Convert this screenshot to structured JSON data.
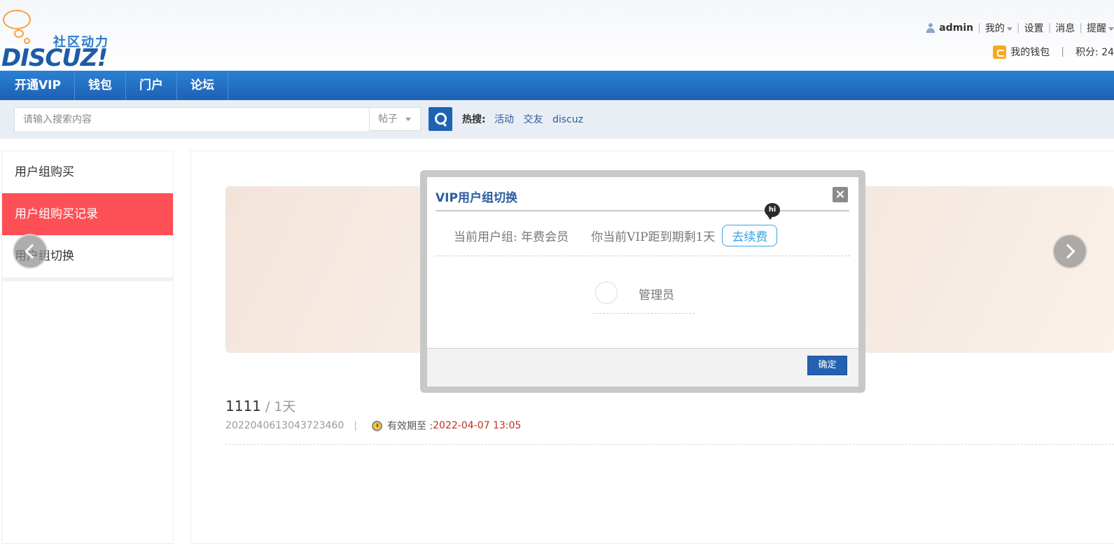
{
  "header": {
    "logo_sub": "社区动力",
    "logo_main": "DISCUZ!",
    "user": {
      "name": "admin",
      "menu": [
        {
          "label": "我的",
          "has_caret": true
        },
        {
          "label": "设置",
          "has_caret": false
        },
        {
          "label": "消息",
          "has_caret": false
        },
        {
          "label": "提醒",
          "has_caret": true
        }
      ]
    },
    "wallet": {
      "label": "我的钱包",
      "points_label": "积分: 24"
    }
  },
  "nav": {
    "items": [
      {
        "label": "开通VIP"
      },
      {
        "label": "钱包"
      },
      {
        "label": "门户"
      },
      {
        "label": "论坛"
      }
    ]
  },
  "search": {
    "placeholder": "请输入搜索内容",
    "type": "帖子",
    "hot_label": "热搜:",
    "hot_links": [
      "活动",
      "交友",
      "discuz"
    ]
  },
  "sidebar": {
    "items": [
      {
        "label": "用户组购买",
        "active": false
      },
      {
        "label": "用户组购买记录",
        "active": true
      },
      {
        "label": "用户组切换",
        "active": false
      }
    ]
  },
  "record": {
    "name": "1111",
    "duration": " / 1天",
    "order_id": "2022040613043723460",
    "separator": "|",
    "expire_label": "有效期至 : ",
    "expire_date": "2022-04-07 13:05"
  },
  "dialog": {
    "title": "VIP用户组切换",
    "close": "×",
    "hi_badge": "hi",
    "current_group": "当前用户组: 年费会员",
    "vip_remaining": "你当前VIP距到期剩1天",
    "renew_label": "去续费",
    "options": [
      {
        "label": "管理员"
      }
    ],
    "confirm_label": "确定"
  },
  "colors": {
    "nav_blue": "#1d61b3",
    "active_red": "#fd5056",
    "link_blue": "#2b5c9e",
    "renew_blue": "#36a3e7",
    "expire_red": "#c0301c"
  }
}
